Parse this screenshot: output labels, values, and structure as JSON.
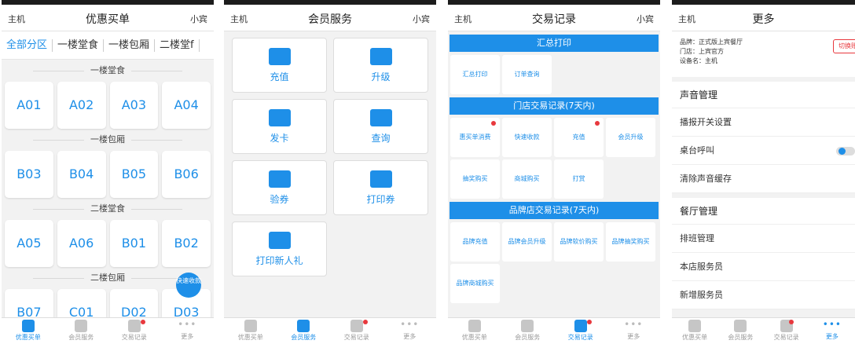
{
  "colors": {
    "accent": "#1e8fe8",
    "badge": "#e8383d"
  },
  "common": {
    "left": "主机",
    "right": "小宾"
  },
  "nav": [
    "优惠买单",
    "会员服务",
    "交易记录",
    "更多"
  ],
  "s1": {
    "title": "优惠买单",
    "tabs": [
      "全部分区",
      "一楼堂食",
      "一楼包厢",
      "二楼堂f"
    ],
    "sections": [
      {
        "name": "一楼堂食",
        "tables": [
          "A01",
          "A02",
          "A03",
          "A04"
        ]
      },
      {
        "name": "一楼包厢",
        "tables": [
          "B03",
          "B04",
          "B05",
          "B06"
        ]
      },
      {
        "name": "二楼堂食",
        "tables": [
          "A05",
          "A06",
          "B01",
          "B02"
        ]
      },
      {
        "name": "二楼包厢",
        "tables": [
          "B07",
          "C01",
          "D02",
          "D03"
        ]
      }
    ],
    "fab": "快速收款"
  },
  "s2": {
    "title": "会员服务",
    "cards": [
      "充值",
      "升级",
      "发卡",
      "查询",
      "验券",
      "打印券",
      "打印新人礼"
    ]
  },
  "s3": {
    "title": "交易记录",
    "groups": [
      {
        "name": "汇总打印",
        "items": [
          "汇总打印",
          "订单查询"
        ]
      },
      {
        "name": "门店交易记录(7天内)",
        "items": [
          "惠买单消费",
          "快速收款",
          "充值",
          "会员升级",
          "抽奖购买",
          "商城购买",
          "打赏"
        ]
      },
      {
        "name": "品牌店交易记录(7天内)",
        "items": [
          "品牌充值",
          "品牌会员升级",
          "品牌软价购买",
          "品牌抽奖购买",
          "品牌商城购买"
        ]
      }
    ]
  },
  "s4": {
    "title": "更多",
    "info": [
      "品牌：正式版上宾餐厅",
      "门店：上宾官方",
      "设备名：主机"
    ],
    "switch_btn": "切换账",
    "g1": "声音管理",
    "g1_rows": [
      "播报开关设置",
      "桌台呼叫",
      "清除声音缓存"
    ],
    "g2": "餐厅管理",
    "g2_rows": [
      "排班管理",
      "本店服务员",
      "新增服务员"
    ]
  }
}
